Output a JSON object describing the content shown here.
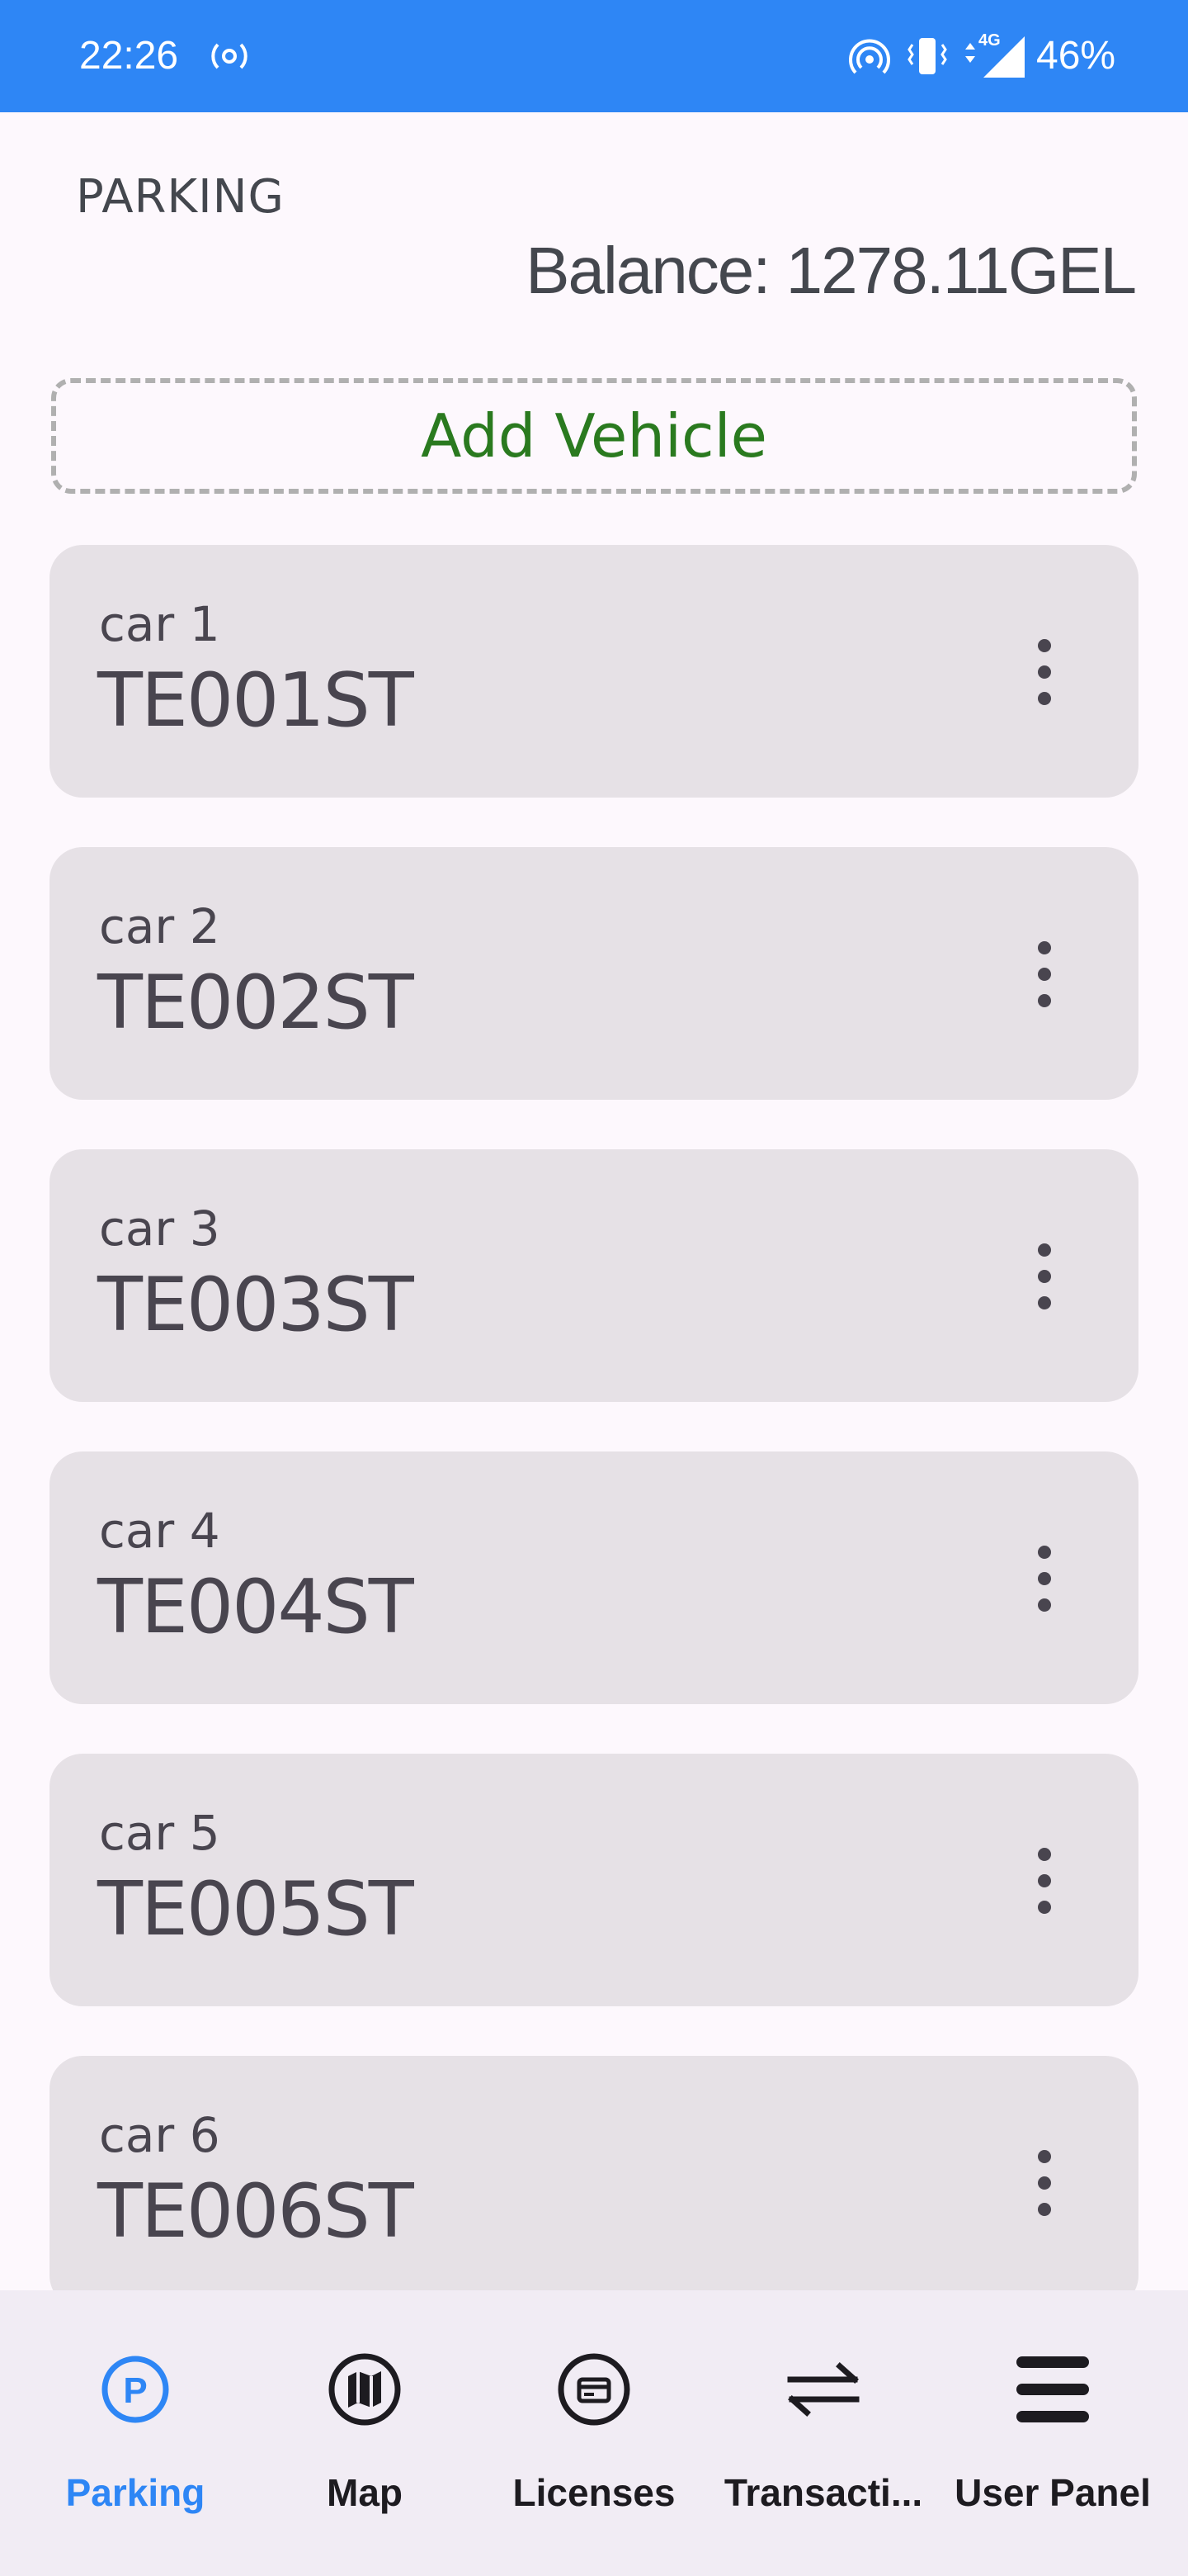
{
  "status_bar": {
    "time": "22:26",
    "data_type": "4G",
    "battery": "46%",
    "icons": [
      "cast-icon",
      "hotspot-icon",
      "vibrate-icon",
      "data-arrows-icon",
      "signal-icon"
    ]
  },
  "header": {
    "title": "PARKING",
    "balance": "Balance:  1278.11GEL"
  },
  "add_vehicle": {
    "label": "Add Vehicle"
  },
  "vehicles": [
    {
      "name": "car 1",
      "plate": "TE001ST"
    },
    {
      "name": "car 2",
      "plate": "TE002ST"
    },
    {
      "name": "car 3",
      "plate": "TE003ST"
    },
    {
      "name": "car 4",
      "plate": "TE004ST"
    },
    {
      "name": "car 5",
      "plate": "TE005ST"
    },
    {
      "name": "car 6",
      "plate": "TE006ST"
    }
  ],
  "bottom_nav": {
    "items": [
      {
        "label": "Parking",
        "icon": "parking-icon",
        "active": true
      },
      {
        "label": "Map",
        "icon": "map-icon",
        "active": false
      },
      {
        "label": "Licenses",
        "icon": "license-card-icon",
        "active": false
      },
      {
        "label": "Transacti...",
        "icon": "transactions-icon",
        "active": false
      },
      {
        "label": "User Panel",
        "icon": "menu-icon",
        "active": false
      }
    ]
  },
  "colors": {
    "status_bar": "#2e86f5",
    "background": "#fdf8fd",
    "card": "#e6e1e6",
    "add_vehicle_text": "#2a7a1f",
    "nav_active": "#2e86f5",
    "nav_bar": "#f1ecf4"
  }
}
